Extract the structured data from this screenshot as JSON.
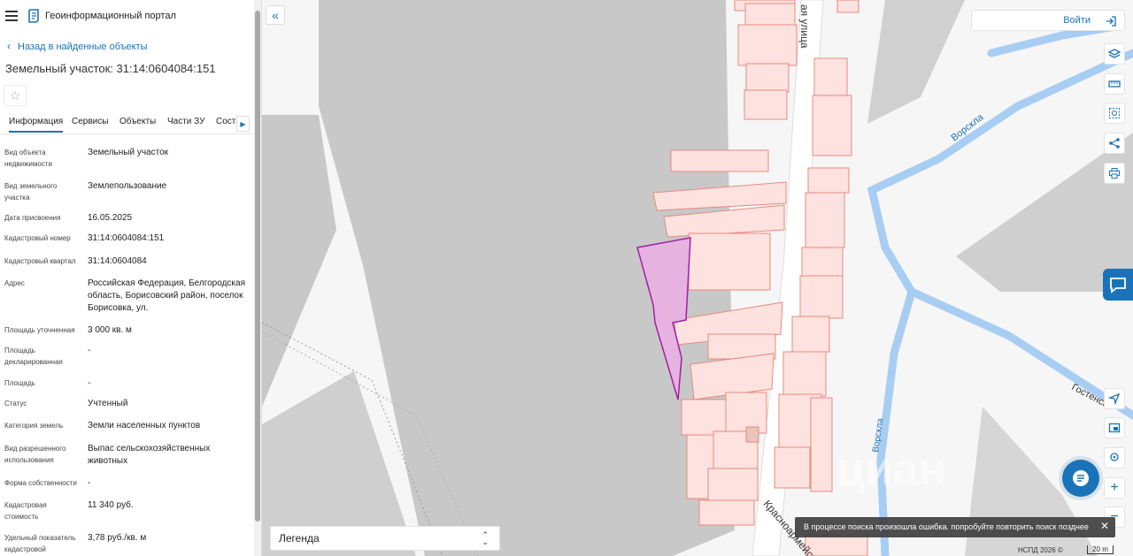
{
  "header": {
    "brand": "Геоинформационный портал"
  },
  "nav": {
    "back_label": "Назад в найденные объекты"
  },
  "object": {
    "title": "Земельный участок: 31:14:0604084:151"
  },
  "tabs": [
    {
      "label": "Информация",
      "active": true
    },
    {
      "label": "Сервисы",
      "active": false
    },
    {
      "label": "Объекты",
      "active": false
    },
    {
      "label": "Части ЗУ",
      "active": false
    },
    {
      "label": "Соста",
      "active": false
    }
  ],
  "attributes": [
    {
      "label": "Вид объекта недвижимости",
      "value": "Земельный участок"
    },
    {
      "label": "Вид земельного участка",
      "value": "Землепользование"
    },
    {
      "label": "Дата присвоения",
      "value": "16.05.2025"
    },
    {
      "label": "Кадастровый номер",
      "value": "31:14:0604084:151"
    },
    {
      "label": "Кадастровый квартал",
      "value": "31:14:0604084"
    },
    {
      "label": "Адрес",
      "value": "Российская Федерация, Белгородская область, Борисовский район, поселок Борисовка, ул."
    },
    {
      "label": "Площадь уточненная",
      "value": "3 000 кв. м"
    },
    {
      "label": "Площадь декларированная",
      "value": "-"
    },
    {
      "label": "Площадь",
      "value": "-"
    },
    {
      "label": "Статус",
      "value": "Учтенный"
    },
    {
      "label": "Категория земель",
      "value": "Земли населенных пунктов"
    },
    {
      "label": "Вид разрешенного использования",
      "value": "Выпас сельскохозяйственных животных"
    },
    {
      "label": "Форма собственности",
      "value": "-"
    },
    {
      "label": "Кадастровая стоимость",
      "value": "11 340 руб."
    },
    {
      "label": "Удельный показатель кадастровой",
      "value": "3,78 руб./кв. м"
    }
  ],
  "map": {
    "login_label": "Войти",
    "legend_label": "Легенда",
    "toast": "В процессе поиска произошла ошибка. попробуйте повторить поиск позднее",
    "attribution": "НСПД 2026 ©",
    "scale_label": "20 m",
    "streets": {
      "north": "ая улица",
      "south": "Красноармейск",
      "east": "Гостенск"
    },
    "rivers": {
      "vorskla_1": "Ворскла",
      "vorskla_2": "Ворскла"
    },
    "watermark": "циан",
    "colors": {
      "accent": "#1a73b8",
      "parcel_fill": "#fde2df",
      "parcel_stroke": "#e8897e",
      "selected_fill": "#e6b3e0",
      "selected_stroke": "#a020a0",
      "river": "#a8cdf3",
      "gray_area": "#c8c8c8"
    }
  }
}
